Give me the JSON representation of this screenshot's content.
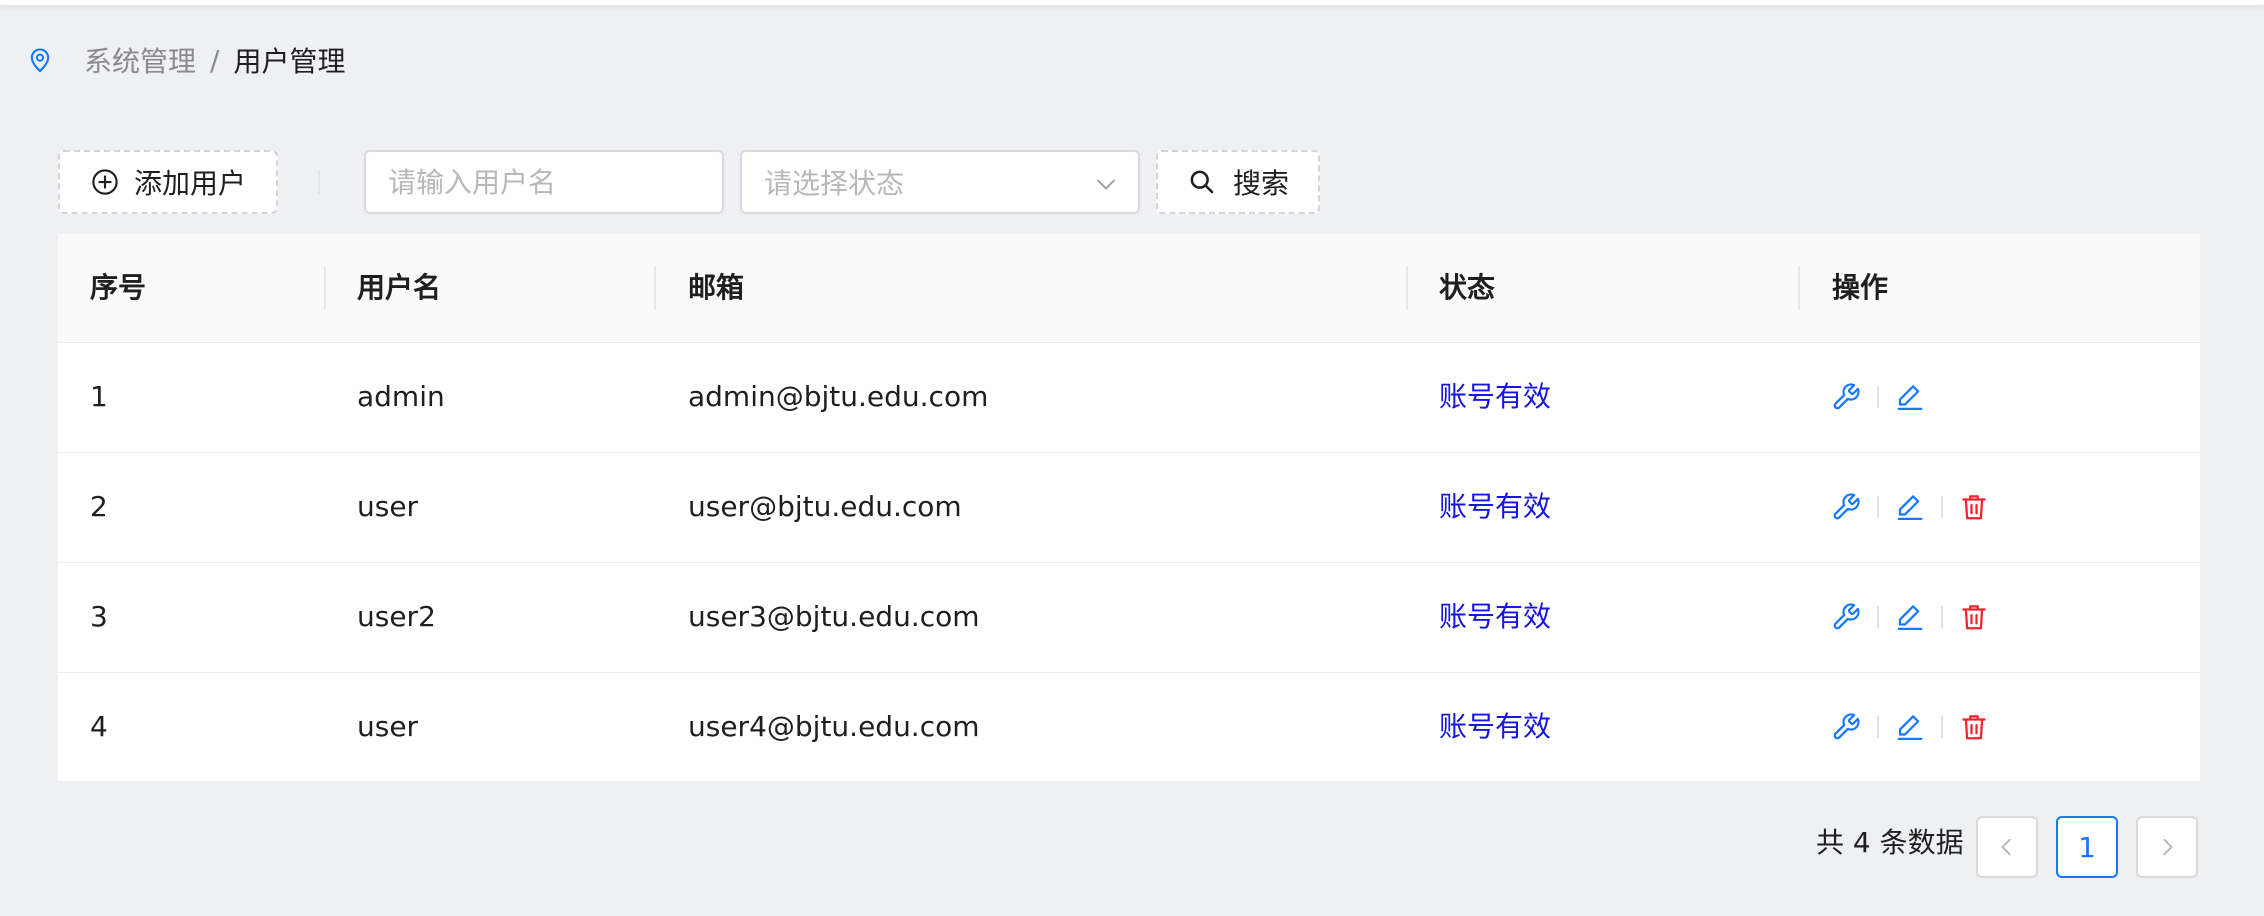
{
  "breadcrumb": {
    "parent": "系统管理",
    "separator": "/",
    "current": "用户管理"
  },
  "toolbar": {
    "add_label": "添加用户",
    "search_placeholder": "请输入用户名",
    "status_placeholder": "请选择状态",
    "search_label": "搜索"
  },
  "table": {
    "headers": [
      "序号",
      "用户名",
      "邮箱",
      "状态",
      "操作"
    ],
    "rows": [
      {
        "index": "1",
        "username": "admin",
        "email": "admin@bjtu.edu.com",
        "status": "账号有效",
        "deletable": false
      },
      {
        "index": "2",
        "username": "user",
        "email": "user@bjtu.edu.com",
        "status": "账号有效",
        "deletable": true
      },
      {
        "index": "3",
        "username": "user2",
        "email": "user3@bjtu.edu.com",
        "status": "账号有效",
        "deletable": true
      },
      {
        "index": "4",
        "username": "user",
        "email": "user4@bjtu.edu.com",
        "status": "账号有效",
        "deletable": true
      }
    ]
  },
  "pagination": {
    "total_text": "共 4 条数据",
    "current_page": "1"
  },
  "colors": {
    "accent": "#1677ff",
    "status_text": "#1616e0",
    "danger": "#f5222d"
  },
  "icons": {
    "breadcrumb": "location-pin-icon",
    "add": "plus-circle-icon",
    "search": "search-icon",
    "select": "chevron-down-icon",
    "row_actions": [
      "wrench-icon",
      "edit-pen-icon",
      "trash-icon"
    ]
  }
}
